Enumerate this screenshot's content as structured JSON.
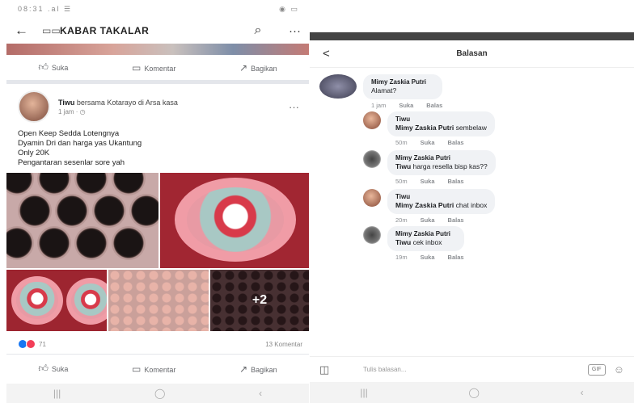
{
  "left": {
    "status": {
      "left": "08:31 .al ☰",
      "right": "◉ ▭"
    },
    "topbar": {
      "back": "←",
      "group_icon": "▭▭",
      "title": "KABAR TAKALAR",
      "search": "⌕",
      "more": "···"
    },
    "actions": {
      "like": "Suka",
      "comment": "Komentar",
      "share": "Bagikan"
    },
    "post": {
      "author": "Tiwu",
      "author_suffix": "bersama Kotarayo di Arsa kasa",
      "time": "1 jam · ◷",
      "more": "···",
      "lines": [
        "Open Keep Sedda Lotengnya",
        "Dyamin Dri dan harga yas Ukantung",
        "Only 20K",
        "Pengantaran sesenlar sore yah"
      ]
    },
    "gallery": {
      "more_count": "+2"
    },
    "reactions": {
      "count": "71",
      "comments": "13 Komentar"
    },
    "actions2": {
      "like": "Suka",
      "comment": "Komentar",
      "share": "Bagikan"
    },
    "nav": [
      "|||",
      "◯",
      "‹"
    ]
  },
  "right": {
    "header": {
      "back": "<",
      "title": "Balasan"
    },
    "comments": [
      {
        "name": "Mimy Zaskia Putri",
        "text": "Alamat?",
        "time": "1 jam",
        "like": "Suka",
        "reply": "Balas"
      },
      {
        "name": "Tiwu",
        "mention": "Mimy Zaskia Putri",
        "text": "sembelaw",
        "time": "50m",
        "like": "Suka",
        "reply": "Balas"
      },
      {
        "name": "Mimy Zaskia Putri",
        "mention": "Tiwu",
        "text": "harga resella bisp kas??",
        "time": "50m",
        "like": "Suka",
        "reply": "Balas"
      },
      {
        "name": "Tiwu",
        "mention": "Mimy Zaskia Putri",
        "text": "chat inbox",
        "time": "20m",
        "like": "Suka",
        "reply": "Balas"
      },
      {
        "name": "Mimy Zaskia Putri",
        "mention": "Tiwu",
        "text": "cek inbox",
        "time": "19m",
        "like": "Suka",
        "reply": "Balas"
      }
    ],
    "input": {
      "placeholder": "Tulis balasan...",
      "gif": "GIF",
      "camera": "◫",
      "emoji": "☺"
    },
    "nav": [
      "|||",
      "◯",
      "‹"
    ]
  },
  "colors": {
    "accent": "#1877f2",
    "bubble": "#f0f2f5",
    "brand_red": "#a12632"
  }
}
